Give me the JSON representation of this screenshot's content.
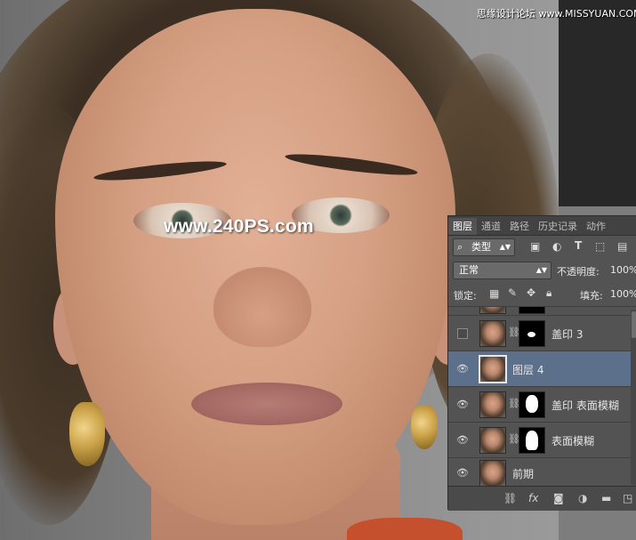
{
  "banner": {
    "site": "思缘设计论坛 www.MISSYUAN.COM"
  },
  "photo": {
    "watermark": "www.240PS.com"
  },
  "layers_panel": {
    "tabs": [
      {
        "label": "图层",
        "active": true
      },
      {
        "label": "通道",
        "active": false
      },
      {
        "label": "路径",
        "active": false
      },
      {
        "label": "历史记录",
        "active": false
      },
      {
        "label": "动作",
        "active": false
      }
    ],
    "filter": {
      "label": "类型",
      "icons": [
        "image-filter-icon",
        "adjustment-filter-icon",
        "text-filter-icon",
        "shape-filter-icon",
        "smart-object-filter-icon"
      ]
    },
    "blend_mode": "正常",
    "opacity": {
      "label": "不透明度:",
      "value": "100%"
    },
    "lock": {
      "label": "锁定:"
    },
    "fill": {
      "label": "填充:",
      "value": "100%"
    },
    "layers": [
      {
        "name": "盖印 3",
        "visible": false,
        "has_mask": true,
        "selected": false
      },
      {
        "name": "图层 4",
        "visible": true,
        "has_mask": false,
        "selected": true
      },
      {
        "name": "盖印 表面模糊",
        "visible": true,
        "has_mask": true,
        "selected": false
      },
      {
        "name": "表面模糊",
        "visible": true,
        "has_mask": true,
        "selected": false
      },
      {
        "name": "前期",
        "visible": true,
        "has_mask": false,
        "selected": false
      }
    ],
    "footer_icons": [
      "link-icon",
      "fx-icon",
      "add-mask-icon",
      "adjustment-layer-icon",
      "new-group-icon",
      "new-layer-icon"
    ]
  }
}
